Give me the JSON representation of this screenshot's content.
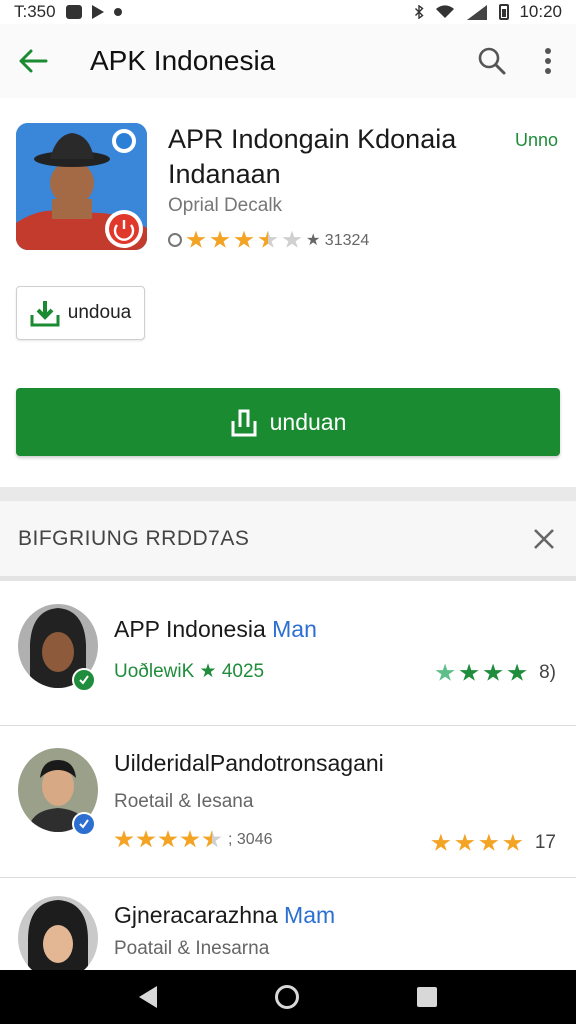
{
  "status_bar": {
    "time_left": "T:350",
    "time_right": "10:20"
  },
  "app_bar": {
    "title": "APK Indonesia",
    "back_icon": "arrow-left-icon",
    "search_icon": "search-icon",
    "more_icon": "more-vert-icon"
  },
  "colors": {
    "brand_green": "#1b8b32",
    "accent_blue": "#2c6fd1",
    "star_orange": "#f4a425",
    "star_green": "#1f8d3b"
  },
  "app": {
    "name": "APR Indongain Kdonaia Indanaan",
    "tag": "Unno",
    "developer": "Oprial Decalk",
    "rating_text": "★ 31324",
    "small_button": "undoua",
    "big_button": "unduan"
  },
  "section": {
    "title": "BIFGRIUNG RRDD7AS"
  },
  "list": [
    {
      "title": "APP Indonesia",
      "title_accent": "Man",
      "sub": "UoðlewiK ★ 4025",
      "right_text": "8)",
      "stars": 4
    },
    {
      "title": "UilderidalPandotronsagani",
      "sub": "Roetail & Iesana",
      "rating_text": "; 3046",
      "right_text": "17",
      "stars": 4.5,
      "right_stars": 4
    },
    {
      "title": "Gjneracarazhna",
      "title_accent": "Mam",
      "sub": "Poatail & Inesarna"
    }
  ]
}
